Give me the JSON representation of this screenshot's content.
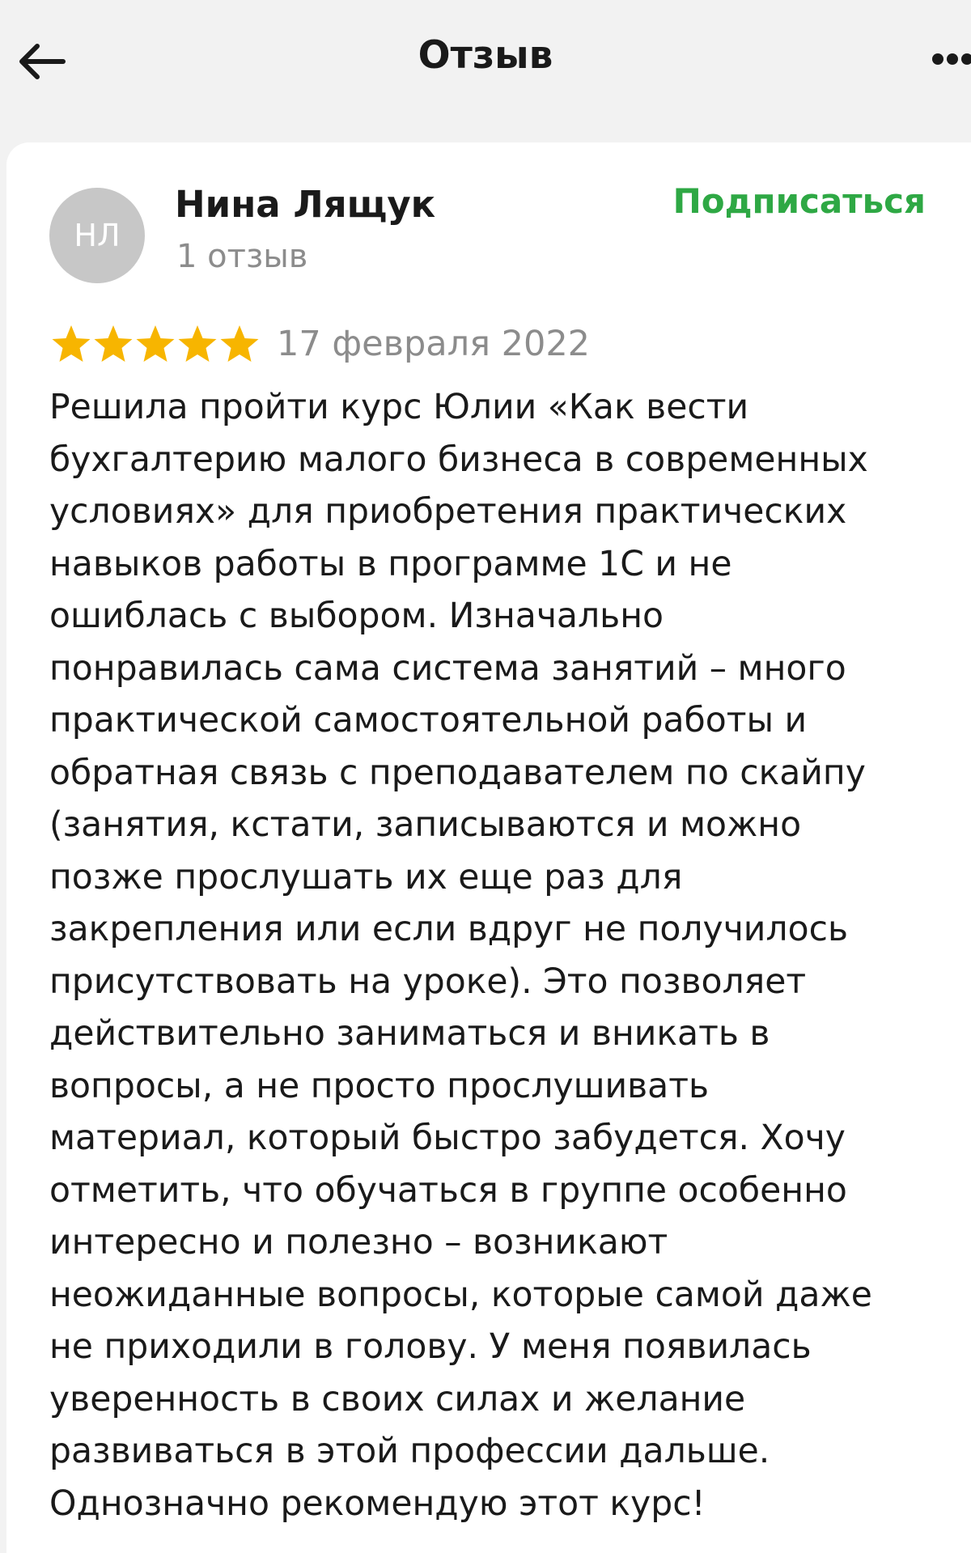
{
  "header": {
    "title": "Отзыв",
    "back_icon": "arrow-left-icon",
    "more_icon": "more-horizontal-icon"
  },
  "review": {
    "author": {
      "initials": "НЛ",
      "name": "Нина Лящук",
      "reviews_count": "1 отзыв"
    },
    "subscribe_label": "Подписаться",
    "rating": 5,
    "rating_max": 5,
    "date": "17 февраля 2022",
    "text": "Решила пройти курс Юлии «Как вести\nбухгалтерию малого бизнеса в современных\nусловиях» для приобретения практических\nнавыков работы в программе 1С и не\nошиблась с выбором. Изначально\nпонравилась сама система занятий – много\nпрактической самостоятельной работы и\nобратная связь с преподавателем по скайпу\n(занятия, кстати, записываются и можно\nпозже прослушать их еще раз для\nзакрепления или если вдруг не получилось\nприсутствовать на уроке). Это позволяет\nдействительно заниматься и вникать в\nвопросы, а не просто прослушивать\nматериал, который быстро забудется. Хочу\nотметить, что обучаться в группе особенно\nинтересно и полезно – возникают\nнеожиданные вопросы, которые самой даже\nне приходили в голову. У меня появилась\nуверенность в своих силах и желание\nразвиваться в этой профессии дальше.\nОднозначно рекомендую этот курс!"
  },
  "colors": {
    "background": "#f2f2f2",
    "card": "#ffffff",
    "accent_green": "#2ea844",
    "star": "#f7b500",
    "muted_text": "#8c8c8c",
    "avatar_bg": "#c7c7c7"
  }
}
